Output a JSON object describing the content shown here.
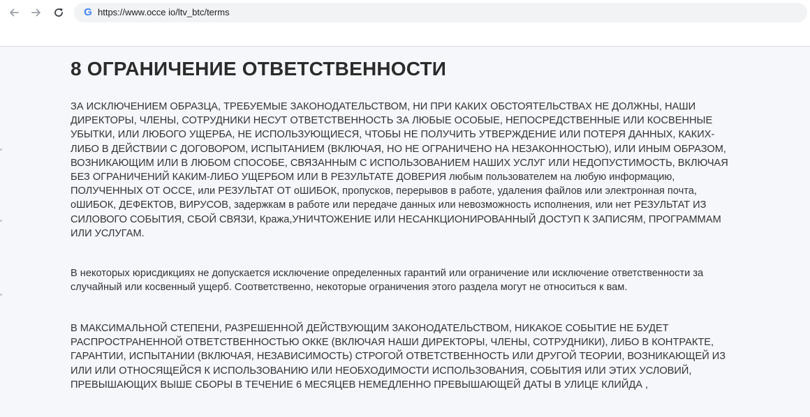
{
  "browser": {
    "url": "https://www.occe io/ltv_btc/terms",
    "back_icon": "arrow-left-icon",
    "forward_icon": "arrow-right-icon",
    "reload_icon": "reload-icon",
    "site_icon": "google-g-icon",
    "site_icon_glyph": "G"
  },
  "page": {
    "heading": "8 ОГРАНИЧЕНИЕ ОТВЕТСТВЕННОСТИ",
    "paragraphs": [
      "ЗА ИСКЛЮЧЕНИЕМ ОБРАЗЦА, ТРЕБУЕМЫЕ ЗАКОНОДАТЕЛЬСТВОМ, НИ ПРИ КАКИХ ОБСТОЯТЕЛЬСТВАХ НЕ ДОЛЖНЫ, НАШИ ДИРЕКТОРЫ, ЧЛЕНЫ, СОТРУДНИКИ НЕСУТ ОТВЕТСТВЕННОСТЬ ЗА ЛЮБЫЕ ОСОБЫЕ, НЕПОСРЕДСТВЕННЫЕ ИЛИ КОСВЕННЫЕ УБЫТКИ, ИЛИ ЛЮБОГО УЩЕРБА, НЕ ИСПОЛЬЗУЮЩИЕСЯ, ЧТОБЫ НЕ ПОЛУЧИТЬ УТВЕРЖДЕНИЕ ИЛИ ПОТЕРЯ ДАННЫХ, КАКИХ-ЛИБО В ДЕЙСТВИИ С ДОГОВОРОМ, ИСПЫТАНИЕМ (ВКЛЮЧАЯ, НО НЕ ОГРАНИЧЕНО НА НЕЗАКОННОСТЬЮ), ИЛИ ИНЫМ ОБРАЗОМ, ВОЗНИКАЮЩИМ ИЛИ В ЛЮБОМ СПОСОБЕ, СВЯЗАННЫМ С ИСПОЛЬЗОВАНИЕМ НАШИХ УСЛУГ ИЛИ НЕДОПУСТИМОСТЬ, ВКЛЮЧАЯ БЕЗ ОГРАНИЧЕНИЙ КАКИМ-ЛИБО УЩЕРБОМ ИЛИ В РЕЗУЛЬТАТЕ ДОВЕРИЯ любым пользователем на любую информацию, ПОЛУЧЕННЫХ ОТ OCCE, или РЕЗУЛЬТАТ ОТ оШИБОК, пропусков, перерывов в работе, удаления файлов или электронная почта, оШИБОК, ДЕФЕКТОВ, ВИРУСОВ, задержкам в работе или передаче данных или невозможность исполнения, или нет РЕЗУЛЬТАТ ИЗ СИЛОВОГО СОБЫТИЯ, СБОЙ СВЯЗИ, Кража,УНИЧТОЖЕНИЕ ИЛИ НЕСАНКЦИОНИРОВАННЫЙ ДОСТУП К ЗАПИСЯМ, ПРОГРАММАМ ИЛИ УСЛУГАМ.",
      "В некоторых юрисдикциях не допускается исключение определенных гарантий или ограничение или исключение ответственности за случайный или косвенный ущерб. Соответственно, некоторые ограничения этого раздела могут не относиться к вам.",
      "В МАКСИМАЛЬНОЙ СТЕПЕНИ, РАЗРЕШЕННОЙ ДЕЙСТВУЮЩИМ ЗАКОНОДАТЕЛЬСТВОМ, НИКАКОЕ СОБЫТИЕ НЕ БУДЕТ РАСПРОСТРАНЕННОЙ ОТВЕТСТВЕННОСТЬЮ ОККЕ (ВКЛЮЧАЯ НАШИ ДИРЕКТОРЫ, ЧЛЕНЫ, СОТРУДНИКИ), ЛИБО В КОНТРАКТЕ, ГАРАНТИИ, ИСПЫТАНИИ (ВКЛЮЧАЯ, НЕЗАВИСИМОСТЬ) СТРОГОЙ ОТВЕТСТВЕННОСТЬ ИЛИ ДРУГОЙ ТЕОРИИ, ВОЗНИКАЮЩЕЙ ИЗ ИЛИ ИЛИ ОТНОСЯЩЕЙСЯ К ИСПОЛЬЗОВАНИЮ ИЛИ НЕОБХОДИМОСТИ ИСПОЛЬЗОВАНИЯ, СОБЫТИЯ ИЛИ ЭТИХ УСЛОВИЙ, ПРЕВЫШАЮЩИХ ВЫШЕ СБОРЫ В ТЕЧЕНИЕ 6 МЕСЯЦЕВ НЕМЕДЛЕННО ПРЕВЫШАЮЩЕЙ ДАТЫ В УЛИЦЕ КЛИЙДА ,"
    ]
  }
}
